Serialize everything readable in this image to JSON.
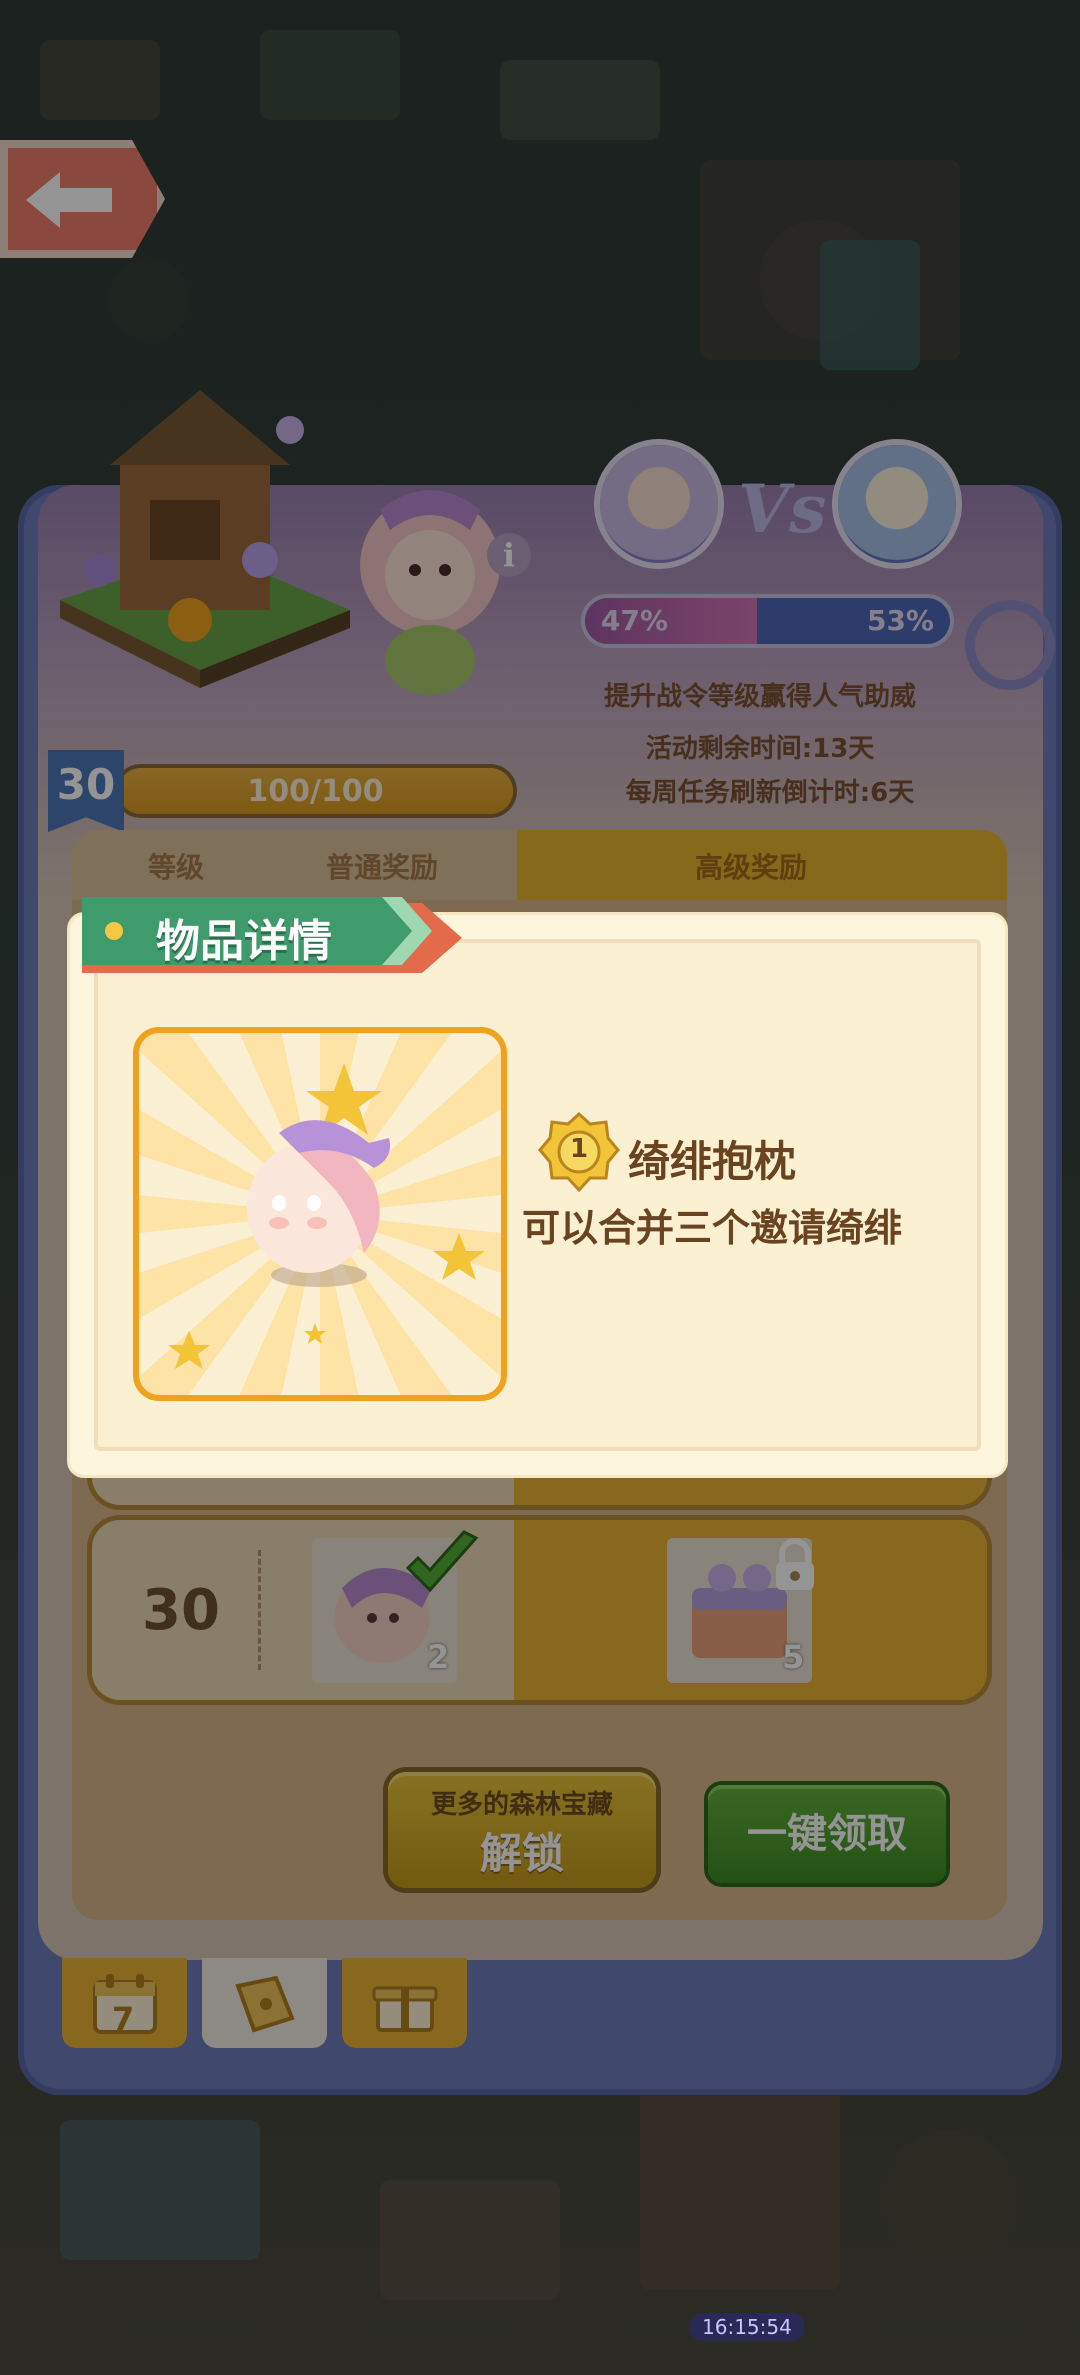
{
  "header": {
    "tip": "提升战令等级赢得人气助威",
    "event_time_left": "活动剩余时间:13天",
    "weekly_refresh": "每周任务刷新倒计时:6天"
  },
  "vote": {
    "vs_label": "Vs",
    "left_percent": "47%",
    "right_percent": "53%",
    "left_fraction": 0.47
  },
  "level": {
    "current": "30",
    "progress_text": "100/100"
  },
  "table": {
    "col_level": "等级",
    "col_normal": "普通奖励",
    "col_premium": "高级奖励"
  },
  "reward_row": {
    "level": "30",
    "normal_count": "2",
    "premium_count": "5"
  },
  "buttons": {
    "unlock_sub": "更多的森林宝藏",
    "unlock_main": "解锁",
    "claim_all": "一键领取"
  },
  "bottom_tabs": {
    "calendar_day": "7"
  },
  "modal": {
    "title": "物品详情",
    "item_level": "1",
    "item_name": "绮绯抱枕",
    "item_desc": "可以合并三个邀请绮绯"
  },
  "status": {
    "time": "16:15:54"
  },
  "colors": {
    "frame_blue": "#6f7dbc",
    "premium_gold": "#e9b62f",
    "claim_green": "#4a9d2e",
    "ribbon_green": "#3f9b6c",
    "modal_cream": "#fdf6dd"
  }
}
